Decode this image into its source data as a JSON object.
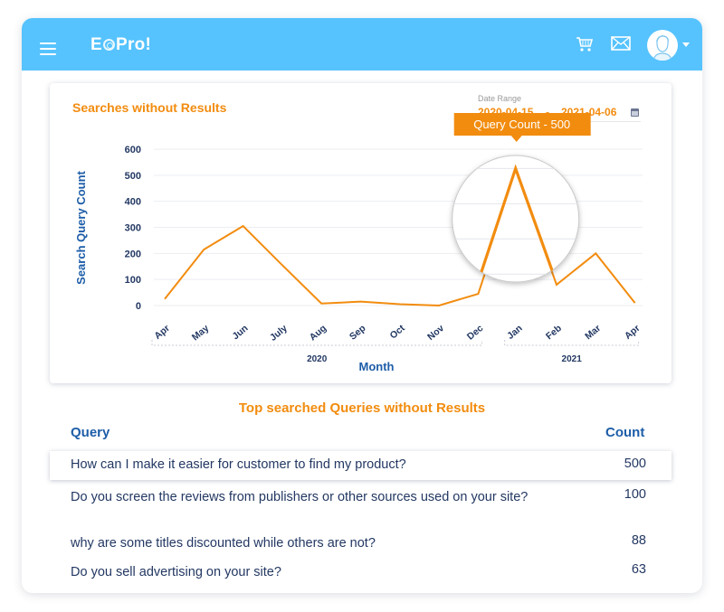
{
  "header": {
    "logo_text_left": "E",
    "logo_text_right": "Pro!",
    "icons": [
      "menu-icon",
      "cart-icon",
      "mail-icon",
      "user-avatar-icon",
      "caret-down-icon"
    ]
  },
  "chart_card": {
    "title": "Searches without Results",
    "date_range": {
      "label": "Date Range",
      "from": "2020-04-15",
      "separator": "-",
      "to": "2021-04-06"
    }
  },
  "chart_data": {
    "type": "line",
    "title": "Searches without Results",
    "xlabel": "Month",
    "ylabel": "Search Query Count",
    "categories": [
      "Apr",
      "May",
      "Jun",
      "July",
      "Aug",
      "Sep",
      "Oct",
      "Nov",
      "Dec",
      "Jan",
      "Feb",
      "Mar",
      "Apr"
    ],
    "year_groups": [
      {
        "label": "2020",
        "from_index": 0,
        "to_index": 8
      },
      {
        "label": "2021",
        "from_index": 9,
        "to_index": 12
      }
    ],
    "series": [
      {
        "name": "Query Count",
        "color": "#f28c0f",
        "values": [
          25,
          215,
          305,
          155,
          8,
          15,
          5,
          0,
          45,
          500,
          80,
          200,
          10
        ]
      }
    ],
    "yticks": [
      0,
      100,
      200,
      300,
      400,
      500,
      600
    ],
    "ylim": [
      0,
      600
    ],
    "grid": true,
    "tooltip": {
      "text": "Query Count - 500",
      "index": 9
    },
    "magnifier_index": 9
  },
  "table": {
    "title": "Top searched Queries without Results",
    "headers": {
      "query": "Query",
      "count": "Count"
    },
    "rows": [
      {
        "query": "How can I make it easier for customer to find my product?",
        "count": "500"
      },
      {
        "query": "Do you screen the reviews from publishers or other sources used on your site?",
        "count": "100"
      },
      {
        "query": "why are some titles discounted while others are not?",
        "count": "88"
      },
      {
        "query": "Do you sell advertising on your site?",
        "count": "63"
      }
    ]
  },
  "colors": {
    "header_bg": "#56c3fe",
    "accent_orange": "#f28c0f",
    "axis_navy": "#233863",
    "axis_title_blue": "#1d5da8"
  }
}
